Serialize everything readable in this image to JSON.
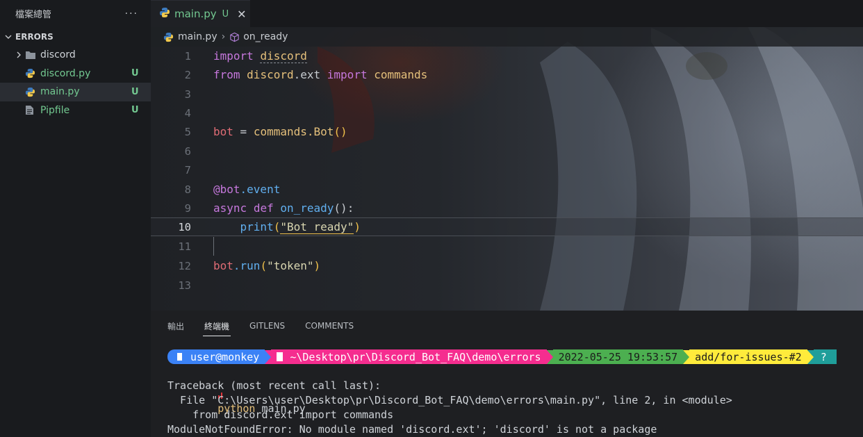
{
  "sidebar": {
    "title": "檔案總管",
    "more_icon": "more-icon",
    "section": "ERRORS",
    "items": [
      {
        "label": "discord",
        "type": "folder",
        "badge": ""
      },
      {
        "label": "discord.py",
        "type": "python",
        "badge": "U"
      },
      {
        "label": "main.py",
        "type": "python",
        "badge": "U"
      },
      {
        "label": "Pipfile",
        "type": "file",
        "badge": "U"
      }
    ]
  },
  "tab": {
    "label": "main.py",
    "badge": "U",
    "close": "✕"
  },
  "breadcrumbs": {
    "file": "main.py",
    "sep": "›",
    "symbol": "on_ready"
  },
  "code": {
    "line_numbers": [
      "1",
      "2",
      "3",
      "4",
      "5",
      "6",
      "7",
      "8",
      "9",
      "10",
      "11",
      "12",
      "13"
    ],
    "l1": {
      "a": "import",
      "b": "discord"
    },
    "l2": {
      "a": "from",
      "b": "discord",
      "c": ".ext",
      "d": "import",
      "e": "commands"
    },
    "l5": {
      "a": "bot",
      "b": " = ",
      "c": "commands",
      "d": ".Bot",
      "e": "()"
    },
    "l8": {
      "a": "@bot",
      "b": ".event"
    },
    "l9": {
      "a": "async",
      "b": "def",
      "c": "on_ready",
      "d": "():"
    },
    "l10": {
      "a": "print",
      "b": "(",
      "c": "\"Bot ready\"",
      "d": ")"
    },
    "l12": {
      "a": "bot",
      "b": ".run",
      "c": "(",
      "d": "\"token\"",
      "e": ")"
    },
    "active_line": "10"
  },
  "panel": {
    "tabs": [
      "輸出",
      "終端機",
      "GITLENS",
      "COMMENTS"
    ],
    "active_tab": "終端機"
  },
  "terminal": {
    "prompt": {
      "user": "user@monkey",
      "path": "~\\Desktop\\pr\\Discord_Bot_FAQ\\demo\\errors",
      "date": "2022-05-25 19:53:57",
      "branch": "add/for-issues-#2",
      "end_symbol": "?"
    },
    "command_prefix": "python",
    "command_arg": "main.py",
    "lines": [
      "Traceback (most recent call last):",
      "  File \"C:\\Users\\user\\Desktop\\pr\\Discord_Bot_FAQ\\demo\\errors\\main.py\", line 2, in <module>",
      "    from discord.ext import commands",
      "ModuleNotFoundError: No module named 'discord.ext'; 'discord' is not a package"
    ]
  },
  "colors": {
    "accent_green": "#73c991",
    "prompt_user": "#3b82f6",
    "prompt_path": "#f52d8f",
    "prompt_date": "#4caf50",
    "prompt_git": "#ffeb3b",
    "prompt_end": "#1f9e9a"
  }
}
